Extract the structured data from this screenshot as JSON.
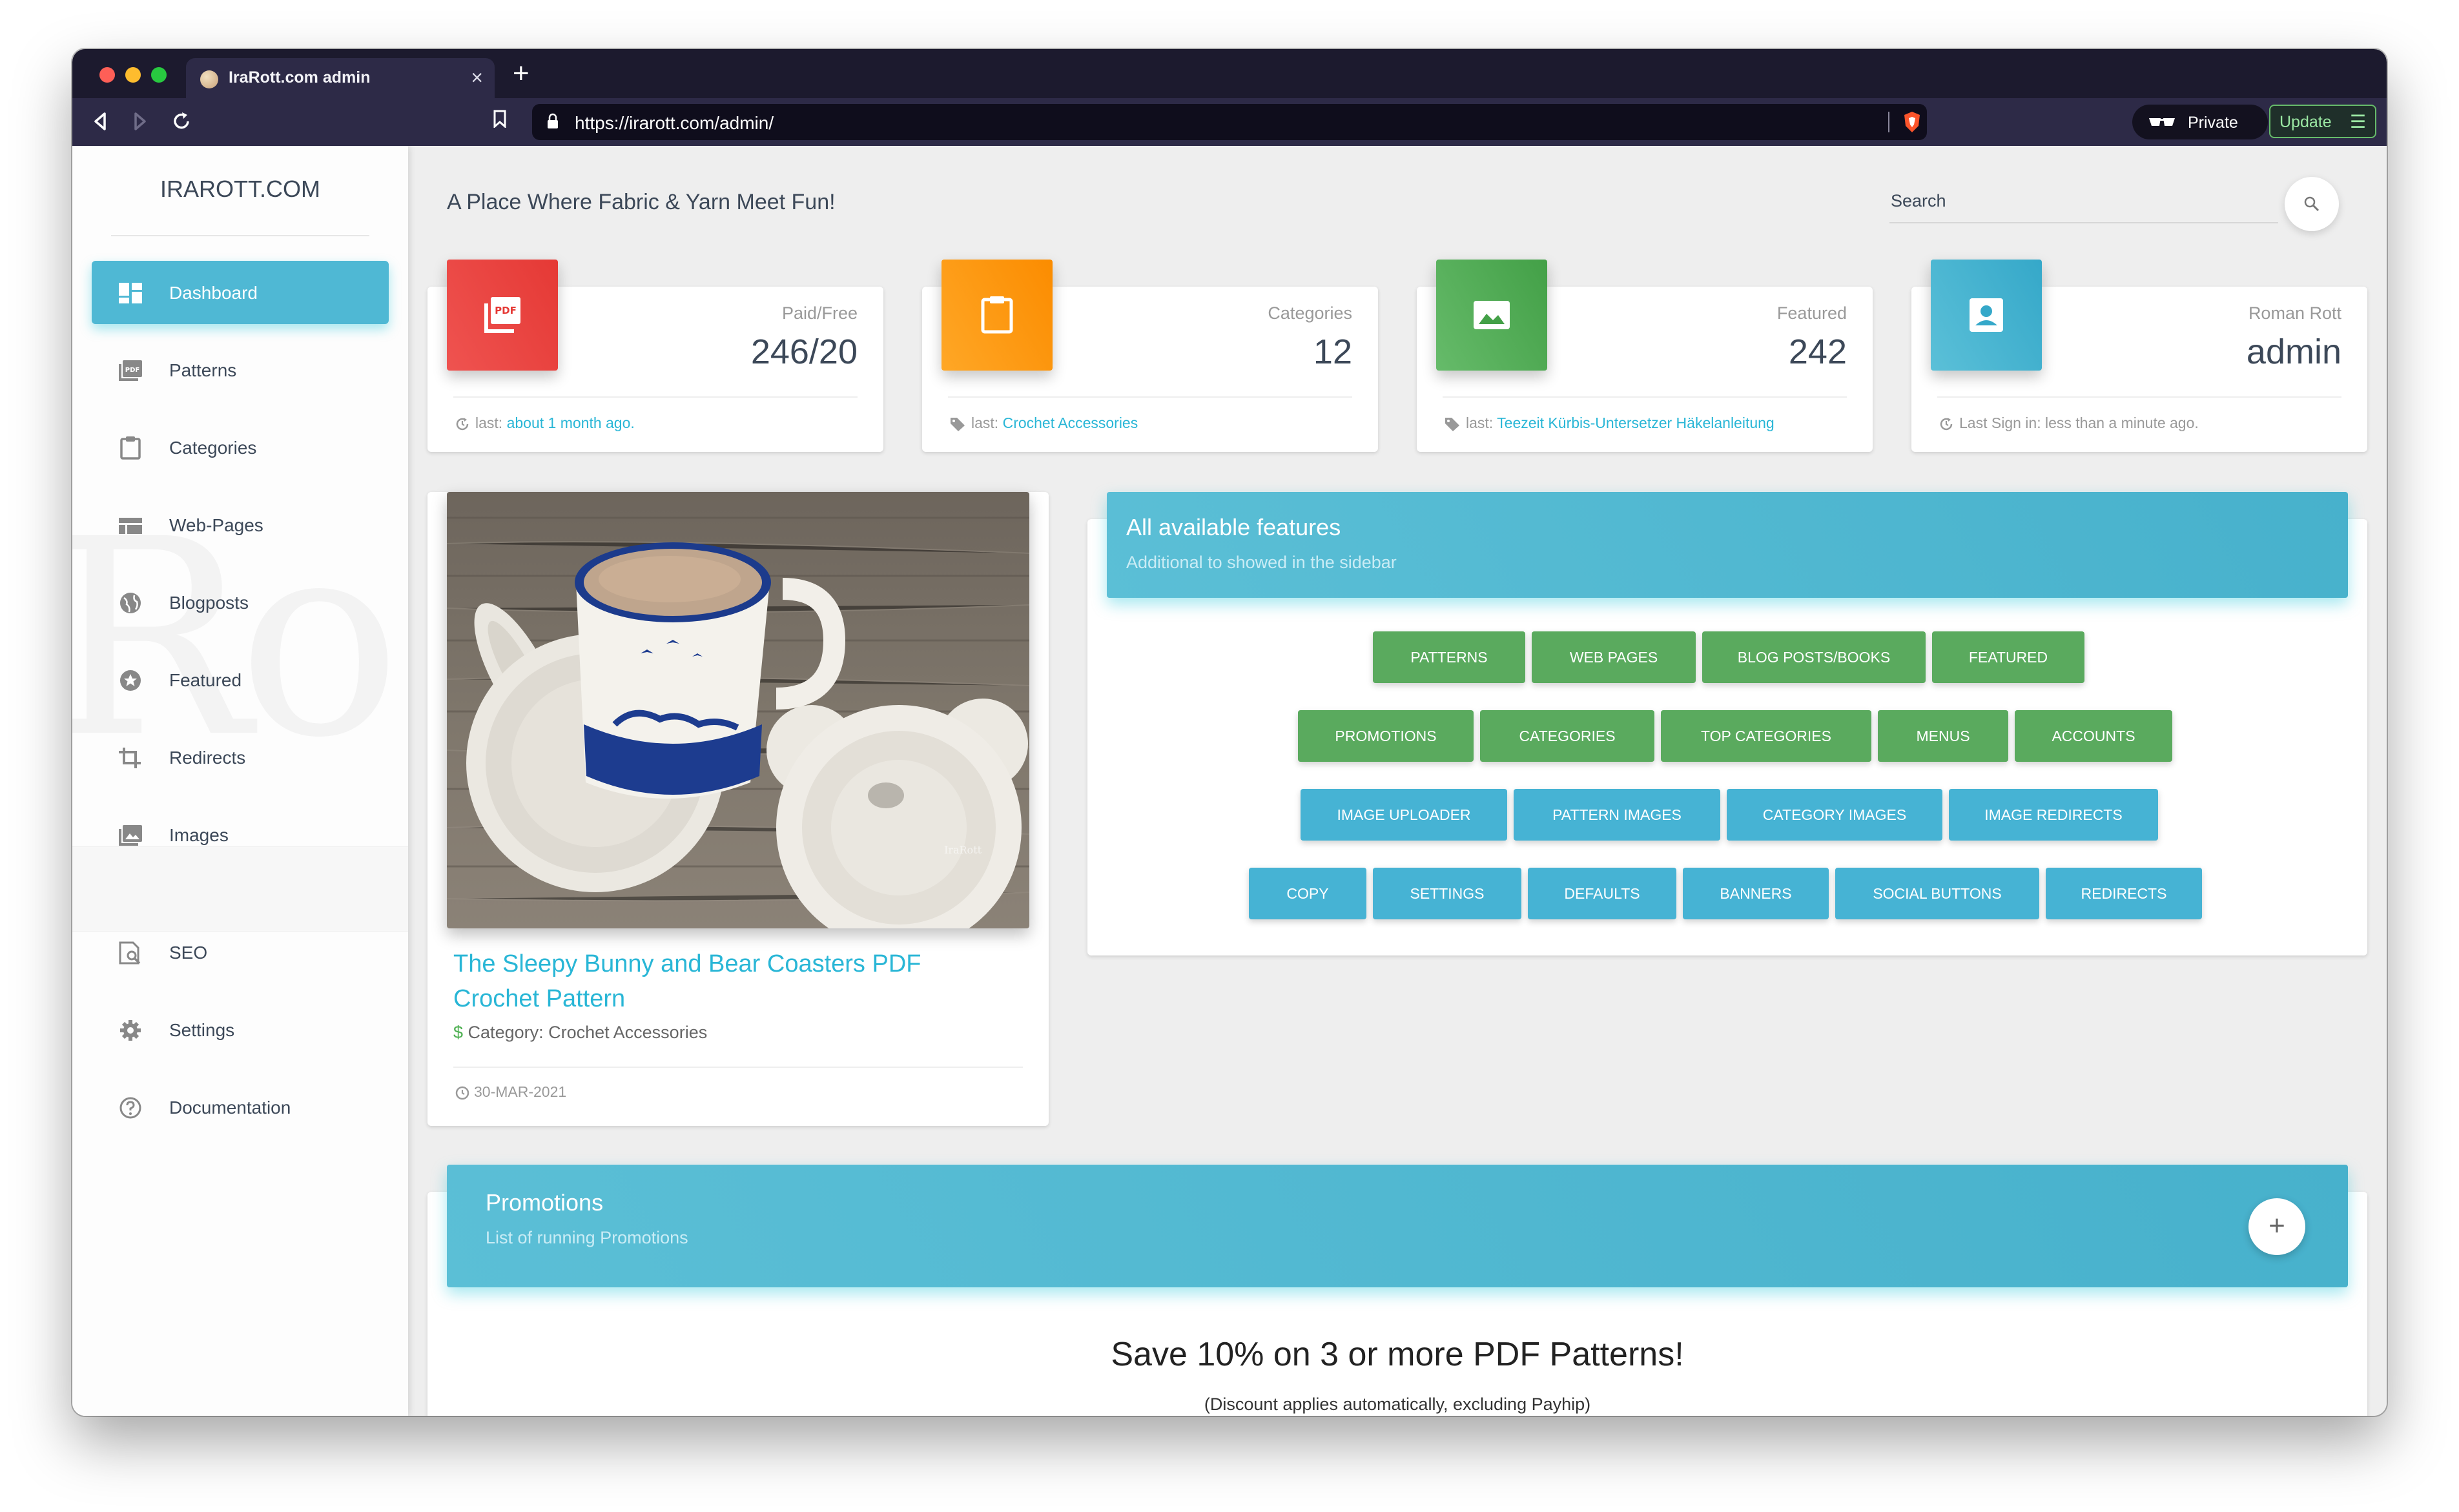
{
  "browser": {
    "tab_title": "IraRott.com admin",
    "url": "https://irarott.com/admin/",
    "private_label": "Private",
    "update_label": "Update"
  },
  "sidebar": {
    "brand": "IRAROTT.COM",
    "items": [
      {
        "label": "Dashboard",
        "icon": "dashboard-icon",
        "active": true
      },
      {
        "label": "Patterns",
        "icon": "pdf-icon"
      },
      {
        "label": "Categories",
        "icon": "clipboard-icon"
      },
      {
        "label": "Web-Pages",
        "icon": "web-icon"
      },
      {
        "label": "Blogposts",
        "icon": "globe-icon"
      },
      {
        "label": "Featured",
        "icon": "star-icon"
      },
      {
        "label": "Redirects",
        "icon": "crop-icon"
      },
      {
        "label": "Images",
        "icon": "image-icon"
      },
      {
        "label": "SEO",
        "icon": "seo-icon"
      },
      {
        "label": "Settings",
        "icon": "gear-icon"
      },
      {
        "label": "Documentation",
        "icon": "help-icon"
      }
    ]
  },
  "header": {
    "tagline": "A Place Where Fabric & Yarn Meet Fun!",
    "search_placeholder": "Search"
  },
  "stats": [
    {
      "label": "Paid/Free",
      "value": "246/20",
      "footer_prefix": "last:",
      "footer_link": "about 1 month ago.",
      "color": "#e53935",
      "icon": "pdf-icon"
    },
    {
      "label": "Categories",
      "value": "12",
      "footer_prefix": "last:",
      "footer_link": "Crochet Accessories",
      "color": "#fb8c00",
      "icon": "clipboard-icon"
    },
    {
      "label": "Featured",
      "value": "242",
      "footer_prefix": "last:",
      "footer_link": "Teezeit Kürbis-Untersetzer Häkelanleitung",
      "color": "#43a047",
      "icon": "image-icon"
    },
    {
      "label": "Roman Rott",
      "value": "admin",
      "footer_prefix": "Last Sign in: less than a minute ago.",
      "footer_link": "",
      "color": "#00acc1",
      "icon": "account-icon"
    }
  ],
  "product": {
    "title": "The Sleepy Bunny and Bear Coasters PDF Crochet Pattern",
    "category_symbol": "$",
    "category": "Category: Crochet Accessories",
    "date": "30-MAR-2021"
  },
  "features": {
    "title": "All available features",
    "subtitle": "Additional to showed in the sidebar",
    "rows": [
      [
        {
          "label": "PATTERNS",
          "color": "green"
        },
        {
          "label": "WEB PAGES",
          "color": "green"
        },
        {
          "label": "BLOG POSTS/BOOKS",
          "color": "green"
        },
        {
          "label": "FEATURED",
          "color": "green"
        }
      ],
      [
        {
          "label": "PROMOTIONS",
          "color": "green"
        },
        {
          "label": "CATEGORIES",
          "color": "green"
        },
        {
          "label": "TOP CATEGORIES",
          "color": "green"
        },
        {
          "label": "MENUS",
          "color": "green"
        },
        {
          "label": "ACCOUNTS",
          "color": "green"
        }
      ],
      [
        {
          "label": "IMAGE UPLOADER",
          "color": "blue"
        },
        {
          "label": "PATTERN IMAGES",
          "color": "blue"
        },
        {
          "label": "CATEGORY IMAGES",
          "color": "blue"
        },
        {
          "label": "IMAGE REDIRECTS",
          "color": "blue"
        }
      ],
      [
        {
          "label": "COPY",
          "color": "blue"
        },
        {
          "label": "SETTINGS",
          "color": "blue"
        },
        {
          "label": "DEFAULTS",
          "color": "blue"
        },
        {
          "label": "BANNERS",
          "color": "blue"
        },
        {
          "label": "SOCIAL BUTTONS",
          "color": "blue"
        },
        {
          "label": "REDIRECTS",
          "color": "blue"
        }
      ]
    ]
  },
  "promotions": {
    "title": "Promotions",
    "subtitle": "List of running Promotions",
    "add_symbol": "+",
    "headline": "Save 10% on 3 or more PDF Patterns!",
    "note": "(Discount applies automatically, excluding Payhip)"
  }
}
